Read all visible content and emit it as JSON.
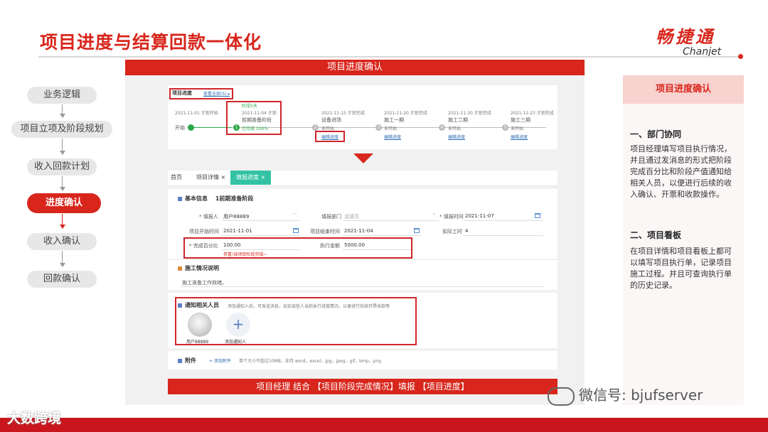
{
  "slide": {
    "title": "项目进度与结算回款一体化",
    "logo_cn": "畅捷通",
    "logo_en": "Chanjet",
    "banner": "项目进度确认",
    "bottom_caption": "项目经理 结合 【项目阶段完成情况】填报 【项目进度】"
  },
  "flow": {
    "steps": [
      {
        "label": "业务逻辑"
      },
      {
        "label": "项目立项及阶段规划"
      },
      {
        "label": "收入回款计划"
      },
      {
        "label": "进度确认"
      },
      {
        "label": "收入确认"
      },
      {
        "label": "回款确认"
      }
    ]
  },
  "progress_card": {
    "tab": "项目进度",
    "tab_hint": "查看全部(5) ▸",
    "start_label": "开始",
    "start_date": "2021-11-01 计划开始",
    "stages": [
      {
        "num": "1",
        "date": "2021-11-04 计划",
        "name": "前期准备阶段",
        "status": "已完成 100%",
        "extra": "阶段5天"
      },
      {
        "num": "2",
        "date": "2021-11-15 计划完成",
        "name": "设备进场",
        "status": "未开始",
        "link": "编辑进度"
      },
      {
        "num": "3",
        "date": "2021-11-20 计划完成",
        "name": "施工一期",
        "status": "未开始",
        "link": "编辑进度"
      },
      {
        "num": "4",
        "date": "2021-11-30 计划完成",
        "name": "施工二期",
        "status": "未开始",
        "link": "编辑进度"
      },
      {
        "num": "5",
        "date": "2021-12-23 计划完成",
        "name": "施工三期",
        "status": "未开始",
        "link": "编辑进度"
      }
    ]
  },
  "form_screen": {
    "tabs": [
      {
        "label": "首页"
      },
      {
        "label": "项目详情 ×"
      },
      {
        "label": "填报进度 ×"
      }
    ],
    "basic_section": "基本信息",
    "basic_stage": "1前期准备阶段",
    "reporter_label": "* 填报人",
    "reporter_value": "用户88889",
    "dept_label": "填报部门",
    "dept_placeholder": "请填写",
    "report_time_label": "* 填报时间",
    "report_time_value": "2021-11-07",
    "start_time_label": "项目开始时间",
    "start_time_value": "2021-11-01",
    "end_time_label": "项目结束时间",
    "end_time_value": "2021-11-04",
    "actual_days_label": "实际工时",
    "actual_days_value": "4",
    "percent_label": "* 完成百分比",
    "percent_value": "100.00",
    "amount_label": "执行金额",
    "amount_value": "5000.00",
    "percent_warning": "恭喜!该项目阶段完结~",
    "construction_section": "施工情况说明",
    "construction_placeholder": "施工准备工作就绪。",
    "notify_section": "通知相关人员",
    "notify_hint": "添加通知人后，可发送消息，告知该些人当前执行进度情况，以便进行后续开票收款等",
    "user_name": "用户88889",
    "add_notify_label": "添加通知人",
    "attach_section": "附件",
    "attach_link": "+ 添加附件",
    "attach_hint": "单个大小不超过10MB，支持 word，excel，jpg，jpeg，gif，bmp，png"
  },
  "side": {
    "header": "项目进度确认",
    "section1_title": "一、部门协同",
    "section1_text": "项目经理填写项目执行情况，并且通过发消息的形式把阶段完成百分比和阶段产值通知给相关人员，以便进行后续的收入确认、开票和收款操作。",
    "section2_title": "二、项目看板",
    "section2_text": "在项目详情和项目看板上都可以填写项目执行单，记录项目施工过程。并且可查询执行单的历史记录。"
  },
  "watermarks": {
    "wechat": "微信号: bjufserver",
    "corner": "大数跨境"
  },
  "colors": {
    "brand_red": "#d8261c",
    "teal_tab": "#33c3a4",
    "done_green": "#2ba84a"
  }
}
